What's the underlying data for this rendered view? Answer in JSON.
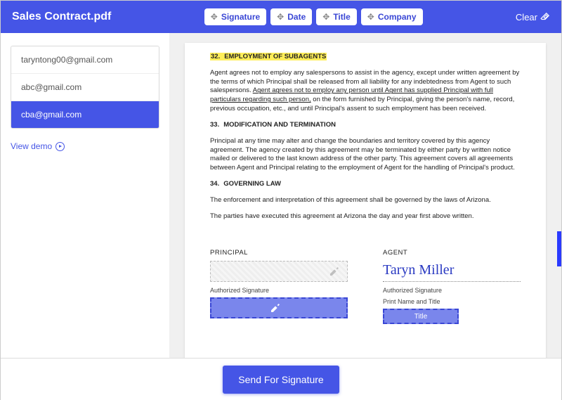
{
  "header": {
    "title": "Sales Contract.pdf",
    "buttons": {
      "signature": "Signature",
      "date": "Date",
      "title_btn": "Title",
      "company": "Company"
    },
    "clear": "Clear"
  },
  "sidebar": {
    "emails": [
      "taryntong00@gmail.com",
      "abc@gmail.com",
      "cba@gmail.com"
    ],
    "view_demo": "View demo"
  },
  "doc": {
    "s32_num": "32.",
    "s32_title": "EMPLOYMENT OF SUBAGENTS",
    "s32_body_a": "Agent agrees not to employ any salespersons to assist in the agency, except under written agreement by the terms of which Principal shall be released from all liability for any indebtedness from Agent to such salespersons. ",
    "s32_body_b": "Agent agrees not to employ any person until Agent has supplied Principal with full particulars regarding such person,",
    "s32_body_c": " on the form furnished by Principal, giving the person's name, record, previous occupation, etc., and until Principal's assent to such employment has been received.",
    "s33_num": "33.",
    "s33_title": "MODIFICATION AND TERMINATION",
    "s33_body": "Principal at any time may alter and change the boundaries and territory covered by this agency agreement. The agency created by this agreement may be terminated by either party by written notice mailed or delivered to the last known address of the other party. This agreement covers all agreements between Agent and Principal relating to the employment of Agent for the handling of Principal's product.",
    "s34_num": "34.",
    "s34_title": "GOVERNING LAW",
    "s34_body_a": "The enforcement and interpretation of this agreement shall be governed by the laws of Arizona.",
    "s34_body_b": "The parties have executed this agreement at Arizona the day and year first above written.",
    "principal": "PRINCIPAL",
    "agent": "AGENT",
    "authorized": "Authorized Signature",
    "print_name": "Print Name and Title",
    "signed_name": "Taryn Miller",
    "title_drop": "Title"
  },
  "footer": {
    "send": "Send For Signature"
  }
}
